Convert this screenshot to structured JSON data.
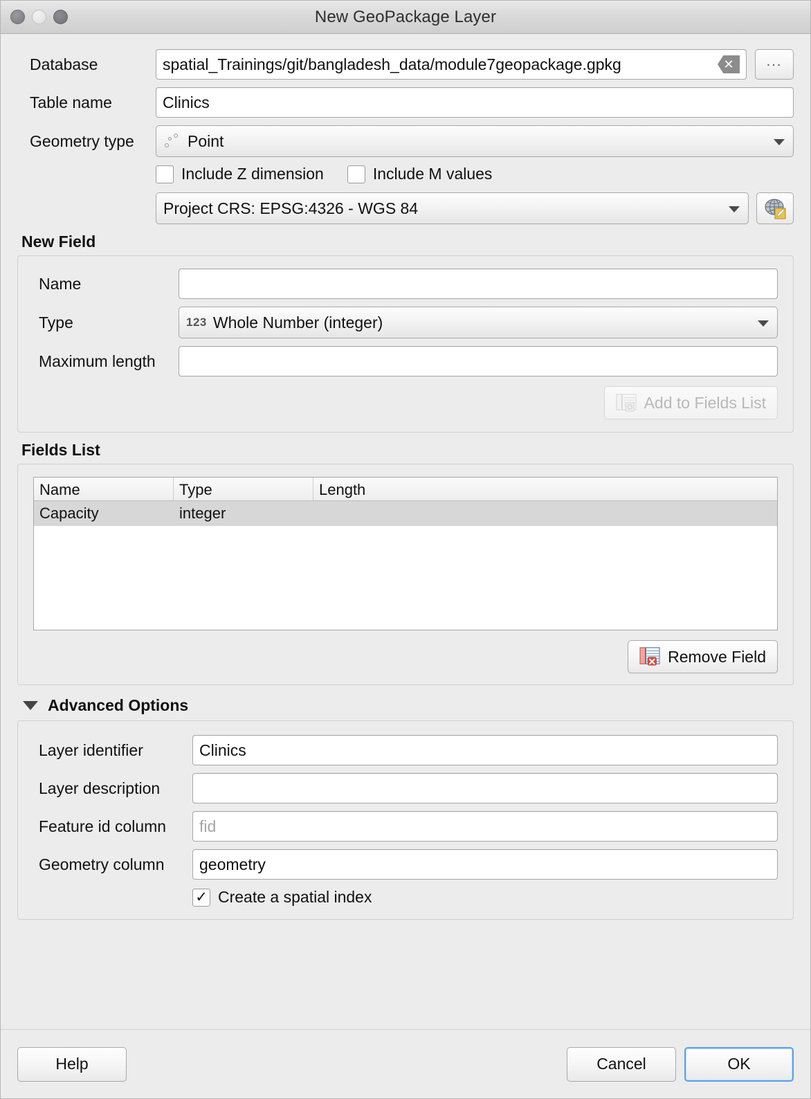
{
  "window": {
    "title": "New GeoPackage Layer",
    "traffic_lights": [
      "close-button",
      "minimize-button",
      "zoom-button"
    ]
  },
  "form": {
    "database": {
      "label": "Database",
      "value": "spatial_Trainings/git/bangladesh_data/module7geopackage.gpkg",
      "clear_icon": "clear-icon",
      "browse_label": "..."
    },
    "table_name": {
      "label": "Table name",
      "value": "Clinics"
    },
    "geometry_type": {
      "label": "Geometry type",
      "value": "Point",
      "icon": "point-geometry-icon"
    },
    "include_z": {
      "label": "Include Z dimension",
      "checked": false
    },
    "include_m": {
      "label": "Include M values",
      "checked": false
    },
    "crs": {
      "value": "Project CRS: EPSG:4326 - WGS 84",
      "select_button_icon": "crs-globe-icon"
    }
  },
  "new_field": {
    "title": "New Field",
    "name": {
      "label": "Name",
      "value": "",
      "placeholder": ""
    },
    "type": {
      "label": "Type",
      "value": "Whole Number (integer)",
      "icon_text": "123"
    },
    "max_length": {
      "label": "Maximum length",
      "value": "",
      "placeholder": ""
    },
    "add_button": {
      "label": "Add to Fields List",
      "enabled": false,
      "icon": "add-field-icon"
    }
  },
  "fields_list": {
    "title": "Fields List",
    "columns": [
      "Name",
      "Type",
      "Length"
    ],
    "rows": [
      {
        "name": "Capacity",
        "type": "integer",
        "length": "",
        "selected": true
      }
    ],
    "remove_button": {
      "label": "Remove Field",
      "icon": "remove-field-icon"
    }
  },
  "advanced_options": {
    "title": "Advanced Options",
    "expanded": true,
    "layer_identifier": {
      "label": "Layer identifier",
      "value": "Clinics"
    },
    "layer_description": {
      "label": "Layer description",
      "value": ""
    },
    "feature_id_column": {
      "label": "Feature id column",
      "value": "",
      "placeholder": "fid"
    },
    "geometry_column": {
      "label": "Geometry column",
      "value": "geometry"
    },
    "spatial_index": {
      "label": "Create a spatial index",
      "checked": true,
      "check_glyph": "✓"
    }
  },
  "footer": {
    "help_label": "Help",
    "cancel_label": "Cancel",
    "ok_label": "OK"
  },
  "colors": {
    "window_bg": "#ececec",
    "field_bg": "#ffffff",
    "selection_row": "#d7d7d7",
    "focus_ring": "#5aa2ea",
    "placeholder": "#a4a4a4",
    "disabled_text": "#b8b8b8"
  }
}
